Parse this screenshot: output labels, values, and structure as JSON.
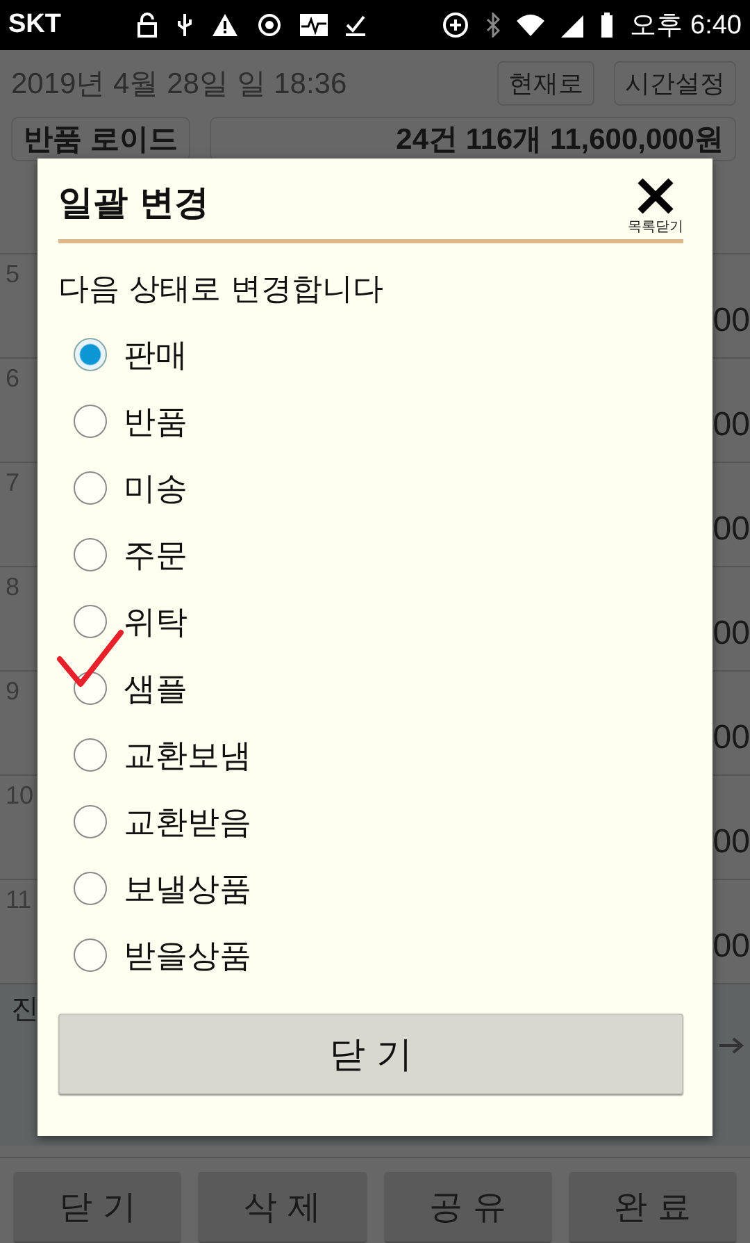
{
  "status_bar": {
    "carrier": "SKT",
    "time": "오후 6:40"
  },
  "header": {
    "datetime": "2019년 4월 28일 일 18:36",
    "buttons": [
      "현재로",
      "시간설정"
    ]
  },
  "summary": {
    "name": "반품 로이드",
    "totals": "24건 116개 11,600,000원"
  },
  "rows": [
    {
      "number": "5",
      "amount": "00"
    },
    {
      "number": "6",
      "amount": "00"
    },
    {
      "number": "7",
      "amount": "00"
    },
    {
      "number": "8",
      "amount": "00"
    },
    {
      "number": "9",
      "amount": "00"
    },
    {
      "number": "10",
      "amount": "00"
    },
    {
      "number": "11",
      "amount": "00"
    }
  ],
  "footer_label": "진",
  "bottom_buttons": [
    "닫 기",
    "삭 제",
    "공 유",
    "완 료"
  ],
  "dialog": {
    "title": "일괄 변경",
    "close_label": "목록닫기",
    "prompt": "다음 상태로 변경합니다",
    "options": [
      {
        "label": "판매",
        "selected": true
      },
      {
        "label": "반품",
        "selected": false
      },
      {
        "label": "미송",
        "selected": false
      },
      {
        "label": "주문",
        "selected": false
      },
      {
        "label": "위탁",
        "selected": false
      },
      {
        "label": "샘플",
        "selected": false
      },
      {
        "label": "교환보냄",
        "selected": false
      },
      {
        "label": "교환받음",
        "selected": false
      },
      {
        "label": "보낼상품",
        "selected": false
      },
      {
        "label": "받을상품",
        "selected": false
      }
    ],
    "button": "닫 기"
  }
}
